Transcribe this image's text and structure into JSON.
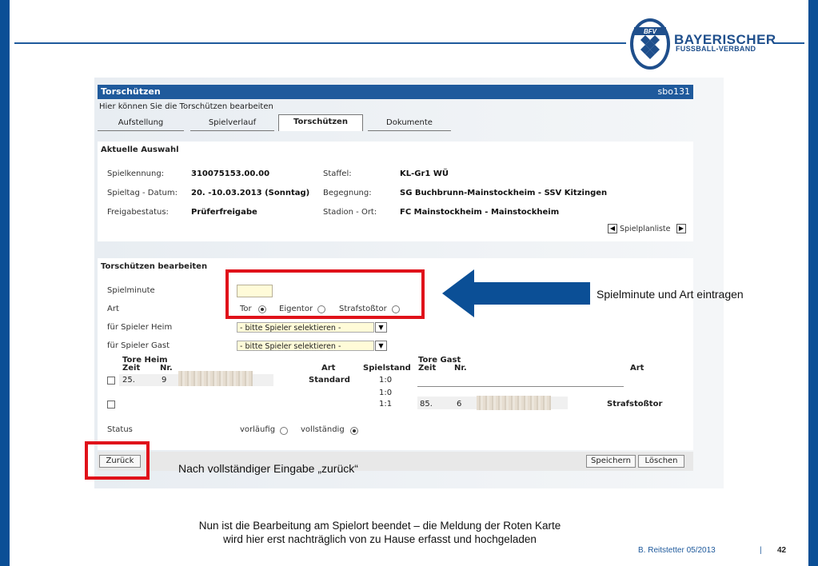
{
  "logo": {
    "line1": "BAYERISCHER",
    "line2": "FUSSBALL-VERBAND",
    "mark": "BFV"
  },
  "app": {
    "title": "Torschützen",
    "id": "sbo131",
    "subtitle": "Hier können Sie die Torschützen bearbeiten"
  },
  "tabs": [
    {
      "label": "Aufstellung"
    },
    {
      "label": "Spielverlauf"
    },
    {
      "label": "Torschützen",
      "active": true
    },
    {
      "label": "Dokumente"
    }
  ],
  "selection": {
    "title": "Aktuelle Auswahl",
    "fields": [
      {
        "label": "Spielkennung:",
        "value": "310075153.00.00"
      },
      {
        "label": "Spieltag - Datum:",
        "value": "20. -10.03.2013 (Sonntag)"
      },
      {
        "label": "Freigabestatus:",
        "value": "Prüferfreigabe"
      },
      {
        "label": "Staffel:",
        "value": "KL-Gr1 WÜ"
      },
      {
        "label": "Begegnung:",
        "value": "SG Buchbrunn-Mainstockheim - SSV Kitzingen"
      },
      {
        "label": "Stadion - Ort:",
        "value": "FC Mainstockheim - Mainstockheim"
      }
    ],
    "nav_label": "Spielplanliste"
  },
  "edit": {
    "title": "Torschützen bearbeiten",
    "spielminute_label": "Spielminute",
    "spielminute_value": "",
    "art_label": "Art",
    "art_options": [
      {
        "label": "Tor",
        "checked": true
      },
      {
        "label": "Eigentor",
        "checked": false
      },
      {
        "label": "Strafstoßtor",
        "checked": false
      }
    ],
    "heim_label": "für Spieler Heim",
    "heim_select": "- bitte Spieler selektieren -",
    "gast_label": "für Spieler Gast",
    "gast_select": "- bitte Spieler selektieren -",
    "table": {
      "heim_title": "Tore Heim",
      "gast_title": "Tore Gast",
      "headers": {
        "zeit": "Zeit",
        "nr": "Nr.",
        "art": "Art",
        "spielstand": "Spielstand"
      },
      "heim_rows": [
        {
          "zeit": "25.",
          "nr": "9",
          "art": "Standard"
        }
      ],
      "spielstand": [
        "1:0",
        "1:0",
        "1:1"
      ],
      "gast_rows": [
        {
          "zeit": "85.",
          "nr": "6",
          "art": "Strafstoßtor"
        }
      ]
    },
    "status_label": "Status",
    "status_options": [
      {
        "label": "vorläufig",
        "checked": false
      },
      {
        "label": "vollständig",
        "checked": true
      }
    ]
  },
  "buttons": {
    "back": "Zurück",
    "save": "Speichern",
    "delete": "Löschen"
  },
  "annotations": {
    "arrow_text": "Spielminute und Art eintragen",
    "back_text": "Nach vollständiger Eingabe „zurück“",
    "note_line1": "Nun ist die Bearbeitung am Spielort beendet – die Meldung der Roten Karte",
    "note_line2": "wird hier erst nachträglich von zu Hause erfasst und hochgeladen"
  },
  "footer": {
    "author": "B. Reitstetter  05/2013",
    "sep": "|",
    "page": "42"
  },
  "colors": {
    "brand": "#1f5a9c",
    "highlight": "#e0121a",
    "input": "#fffbd8"
  }
}
